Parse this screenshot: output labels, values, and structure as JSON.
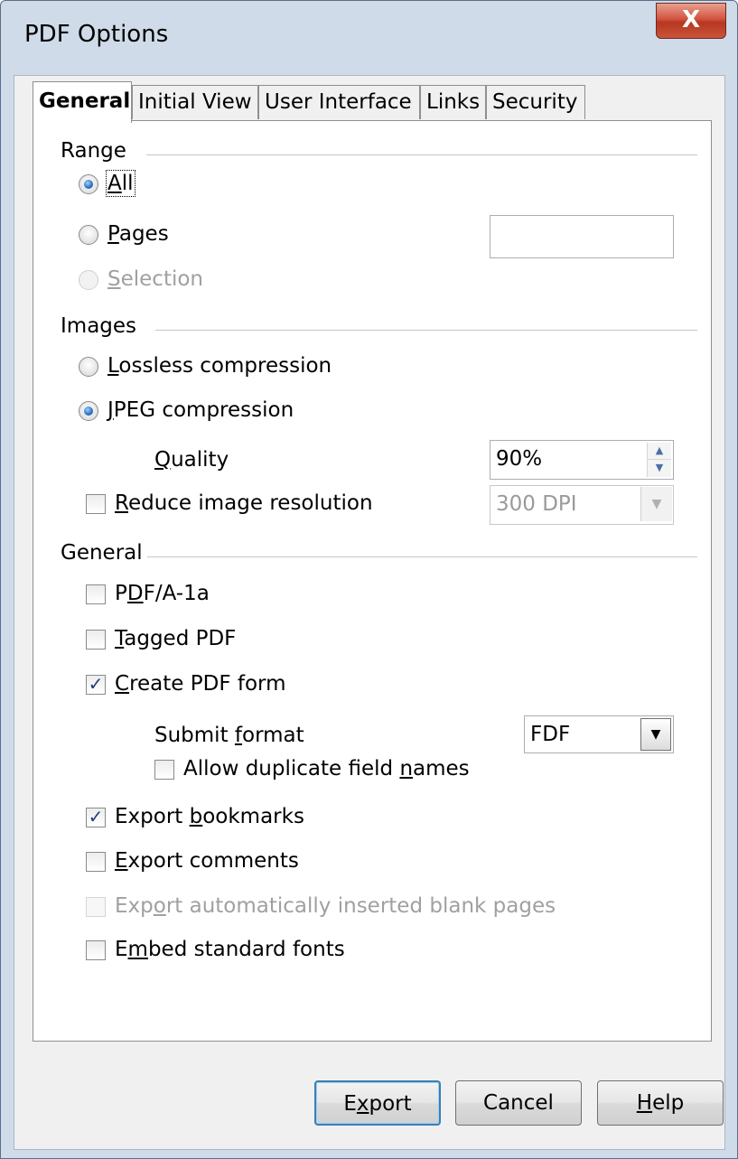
{
  "window": {
    "title": "PDF Options",
    "close_glyph": "X"
  },
  "tabs": [
    {
      "label": "General"
    },
    {
      "label": "Initial View"
    },
    {
      "label": "User Interface"
    },
    {
      "label": "Links"
    },
    {
      "label": "Security"
    }
  ],
  "range": {
    "heading": "Range",
    "all_label": "All",
    "pages_label": "Pages",
    "pages_value": "",
    "selection_label": "Selection"
  },
  "images": {
    "heading": "Images",
    "lossless_label": "Lossless compression",
    "jpeg_label": "JPEG compression",
    "quality_label": "Quality",
    "quality_value": "90%",
    "reduce_label": "Reduce image resolution",
    "resolution_value": "300 DPI"
  },
  "general": {
    "heading": "General",
    "pdfa_label": "PDF/A-1a",
    "tagged_label": "Tagged PDF",
    "create_form_label": "Create PDF form",
    "submit_format_label": "Submit format",
    "submit_format_value": "FDF",
    "allow_duplicate_label": "Allow duplicate field names",
    "export_bookmarks_label": "Export bookmarks",
    "export_comments_label": "Export comments",
    "export_blank_label": "Export automatically inserted blank pages",
    "embed_fonts_label": "Embed standard fonts"
  },
  "buttons": {
    "export": "Export",
    "cancel": "Cancel",
    "help": "Help"
  },
  "colors": {
    "accent": "#3c7fb1",
    "close": "#c9553a"
  }
}
